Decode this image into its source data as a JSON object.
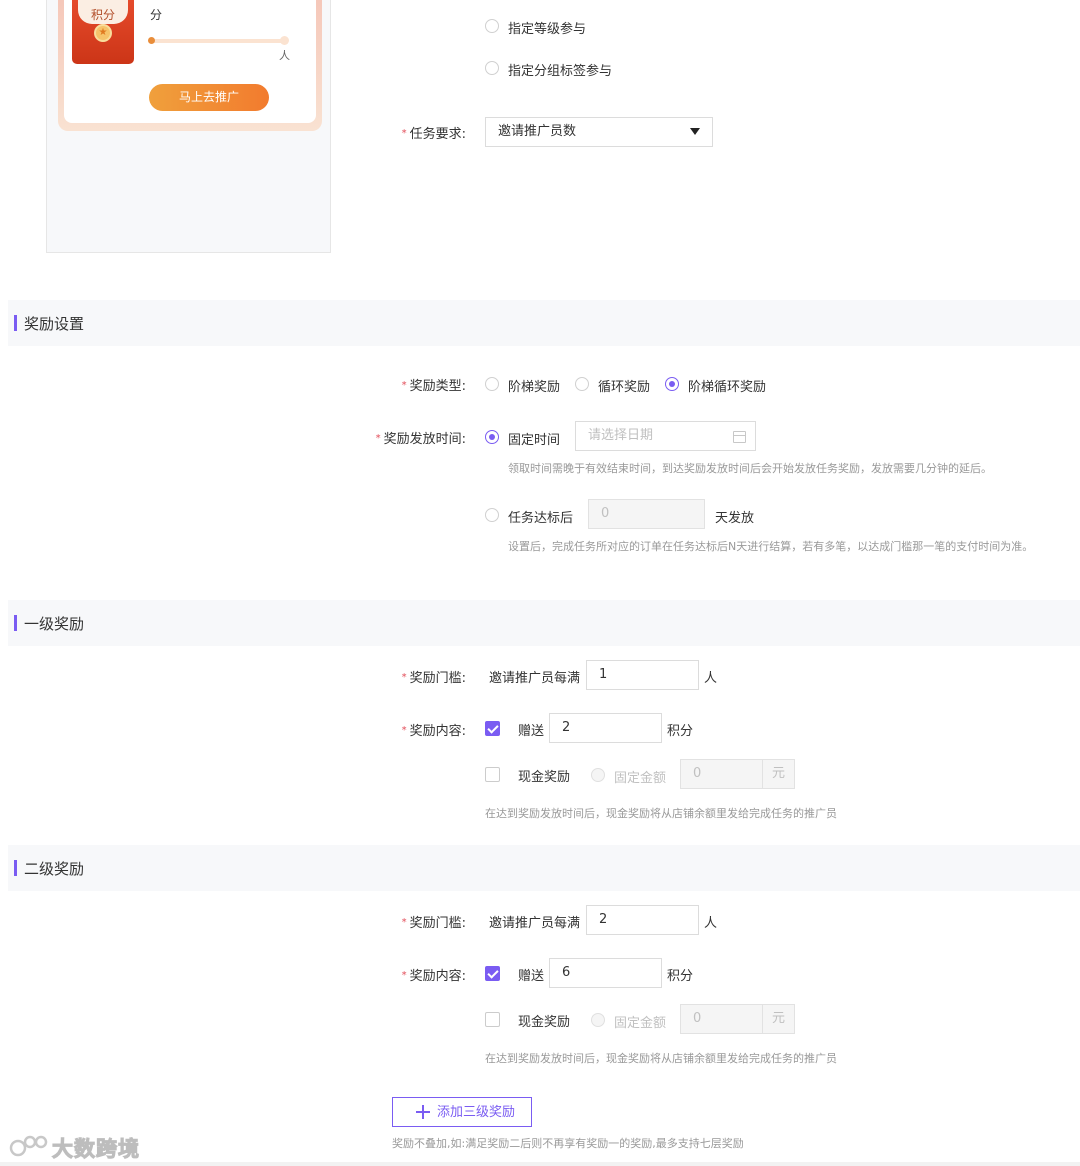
{
  "accent_color": "#7a5cf2",
  "preview": {
    "envelope_label": "积分",
    "points_unit": "分",
    "progress_unit": "人",
    "progress_fraction": 0.02,
    "button_label": "马上去推广"
  },
  "participation": {
    "options": [
      "指定等级参与",
      "指定分组标签参与"
    ]
  },
  "task_requirement": {
    "label": "任务要求:",
    "selected": "邀请推广员数"
  },
  "reward_settings": {
    "section_title": "奖励设置",
    "reward_type": {
      "label": "奖励类型:",
      "options": [
        "阶梯奖励",
        "循环奖励",
        "阶梯循环奖励"
      ],
      "selected": "阶梯循环奖励"
    },
    "release_time": {
      "label": "奖励发放时间:",
      "fixed_label": "固定时间",
      "date_placeholder": "请选择日期",
      "fixed_hint": "领取时间需晚于有效结束时间，到达奖励发放时间后会开始发放任务奖励，发放需要几分钟的延后。",
      "after_label": "任务达标后",
      "days_value": "0",
      "days_suffix": "天发放",
      "after_hint": "设置后，完成任务所对应的订单在任务达标后N天进行结算，若有多笔，以达成门槛那一笔的支付时间为准。"
    }
  },
  "levels": [
    {
      "section_title": "一级奖励",
      "threshold_label": "奖励门槛:",
      "threshold_prefix": "邀请推广员每满",
      "threshold_value": "1",
      "threshold_unit": "人",
      "content_label": "奖励内容:",
      "gift_label": "赠送",
      "gift_value": "2",
      "gift_unit": "积分",
      "cash_label": "现金奖励",
      "fixed_amount_label": "固定金额",
      "cash_value": "0",
      "cash_unit": "元",
      "hint": "在达到奖励发放时间后，现金奖励将从店铺余额里发给完成任务的推广员"
    },
    {
      "section_title": "二级奖励",
      "threshold_label": "奖励门槛:",
      "threshold_prefix": "邀请推广员每满",
      "threshold_value": "2",
      "threshold_unit": "人",
      "content_label": "奖励内容:",
      "gift_label": "赠送",
      "gift_value": "6",
      "gift_unit": "积分",
      "cash_label": "现金奖励",
      "fixed_amount_label": "固定金额",
      "cash_value": "0",
      "cash_unit": "元",
      "hint": "在达到奖励发放时间后，现金奖励将从店铺余额里发给完成任务的推广员"
    }
  ],
  "add_level": {
    "button_label": "添加三级奖励",
    "hint": "奖励不叠加,如:满足奖励二后则不再享有奖励一的奖励,最多支持七层奖励"
  },
  "watermark": {
    "text": "大数跨境"
  }
}
